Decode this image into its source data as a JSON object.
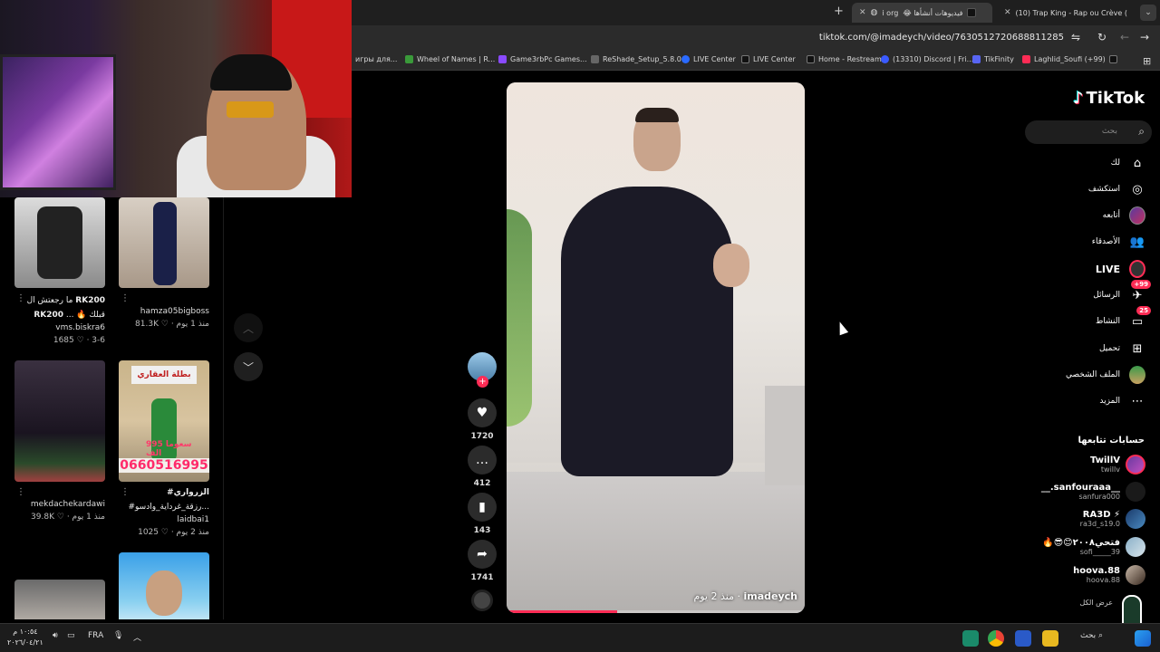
{
  "browser": {
    "tabs": [
      {
        "label": "(10) Trap King - Rap ou Crève (",
        "active": false
      },
      {
        "label": "فيديوهات أنشأها 😂 ‮ gro i",
        "active": true
      }
    ],
    "url": "tiktok.com/@imadeych/video/7630512720688811285",
    "bookmarks": [
      "игры для...",
      "Wheel of Names | R...",
      "Game3rbPc Games...",
      "ReShade_Setup_5.8.0",
      "LIVE Center",
      "LIVE Center",
      "Home - Restream",
      "(13310) Discord | Fri...",
      "TikFinity",
      "Laghlid_Soufi (+99)"
    ]
  },
  "feed": {
    "videos": [
      {
        "title_bold1": "RK200",
        "title_plain": "ما رجعتش ال",
        "title_bold2": "RK200",
        "title_extra": "... 🔥 قبلك",
        "user": "vms.biskra6",
        "likes": "1685",
        "age": "3-6"
      },
      {
        "title_bold1": "",
        "title_plain": "",
        "title_bold2": "",
        "title_extra": "",
        "user": "hamza05bigboss",
        "likes": "81.3K",
        "age": "منذ 1 يوم"
      },
      {
        "title_bold1": "",
        "title_plain": "",
        "title_bold2": "",
        "title_extra": "",
        "user": "mekdachekardawi",
        "likes": "39.8K",
        "age": "منذ 1 يوم"
      },
      {
        "title_bold1": "#الزرواري",
        "title_plain": "#رزقة_غرداية_وادسو...",
        "title_bold2": "",
        "title_extra": "",
        "user": "laidbai1",
        "likes": "1025",
        "age": "منذ 2 يوم"
      }
    ],
    "thumb_texts": {
      "sign": "بطلة العقاري",
      "price": "سعوما 995 الف",
      "phone": "0660516995"
    }
  },
  "video": {
    "author": "imadeych",
    "age": "منذ 2 يوم",
    "progress": 0.37
  },
  "actions": {
    "likes": "1720",
    "comments": "412",
    "saves": "143",
    "shares": "1741"
  },
  "sidebar": {
    "logo": "TikTok",
    "search_placeholder": "بحث",
    "nav": [
      {
        "label": "لك",
        "icon": "home-icon"
      },
      {
        "label": "استكشف",
        "icon": "compass-icon"
      },
      {
        "label": "أتابعه",
        "icon": "following-avatar-icon"
      },
      {
        "label": "الأصدقاء",
        "icon": "friends-icon"
      },
      {
        "label": "LIVE",
        "icon": "live-icon"
      },
      {
        "label": "الرسائل",
        "icon": "messages-icon",
        "badge": "+99"
      },
      {
        "label": "النشاط",
        "icon": "activity-icon",
        "badge": "25"
      },
      {
        "label": "تحميل",
        "icon": "upload-icon"
      },
      {
        "label": "الملف الشخصي",
        "icon": "profile-icon"
      },
      {
        "label": "المزيد",
        "icon": "more-icon"
      }
    ],
    "following_header": "حسابات تتابعها",
    "following": [
      {
        "name": "TwillV",
        "handle": "twillv"
      },
      {
        "name": "__.sanfouraaa__",
        "handle": "sanfura000"
      },
      {
        "name": "RA3D ⚡",
        "handle": "ra3d_s19.0"
      },
      {
        "name": "🔥😎😊فتحي٢٠٠٨",
        "handle": "sofi_____39"
      },
      {
        "name": "hoova.88",
        "handle": "hoova.88"
      }
    ],
    "see_all": "عرض الكل"
  },
  "taskbar": {
    "time": "١٠:٥٤ م",
    "date": "٢٠٢٦/٠٤/٢١",
    "lang": "FRA",
    "search": "بحث"
  },
  "colors": {
    "accent": "#fe2c55",
    "cyan": "#25f4ee",
    "bg": "#000000"
  }
}
